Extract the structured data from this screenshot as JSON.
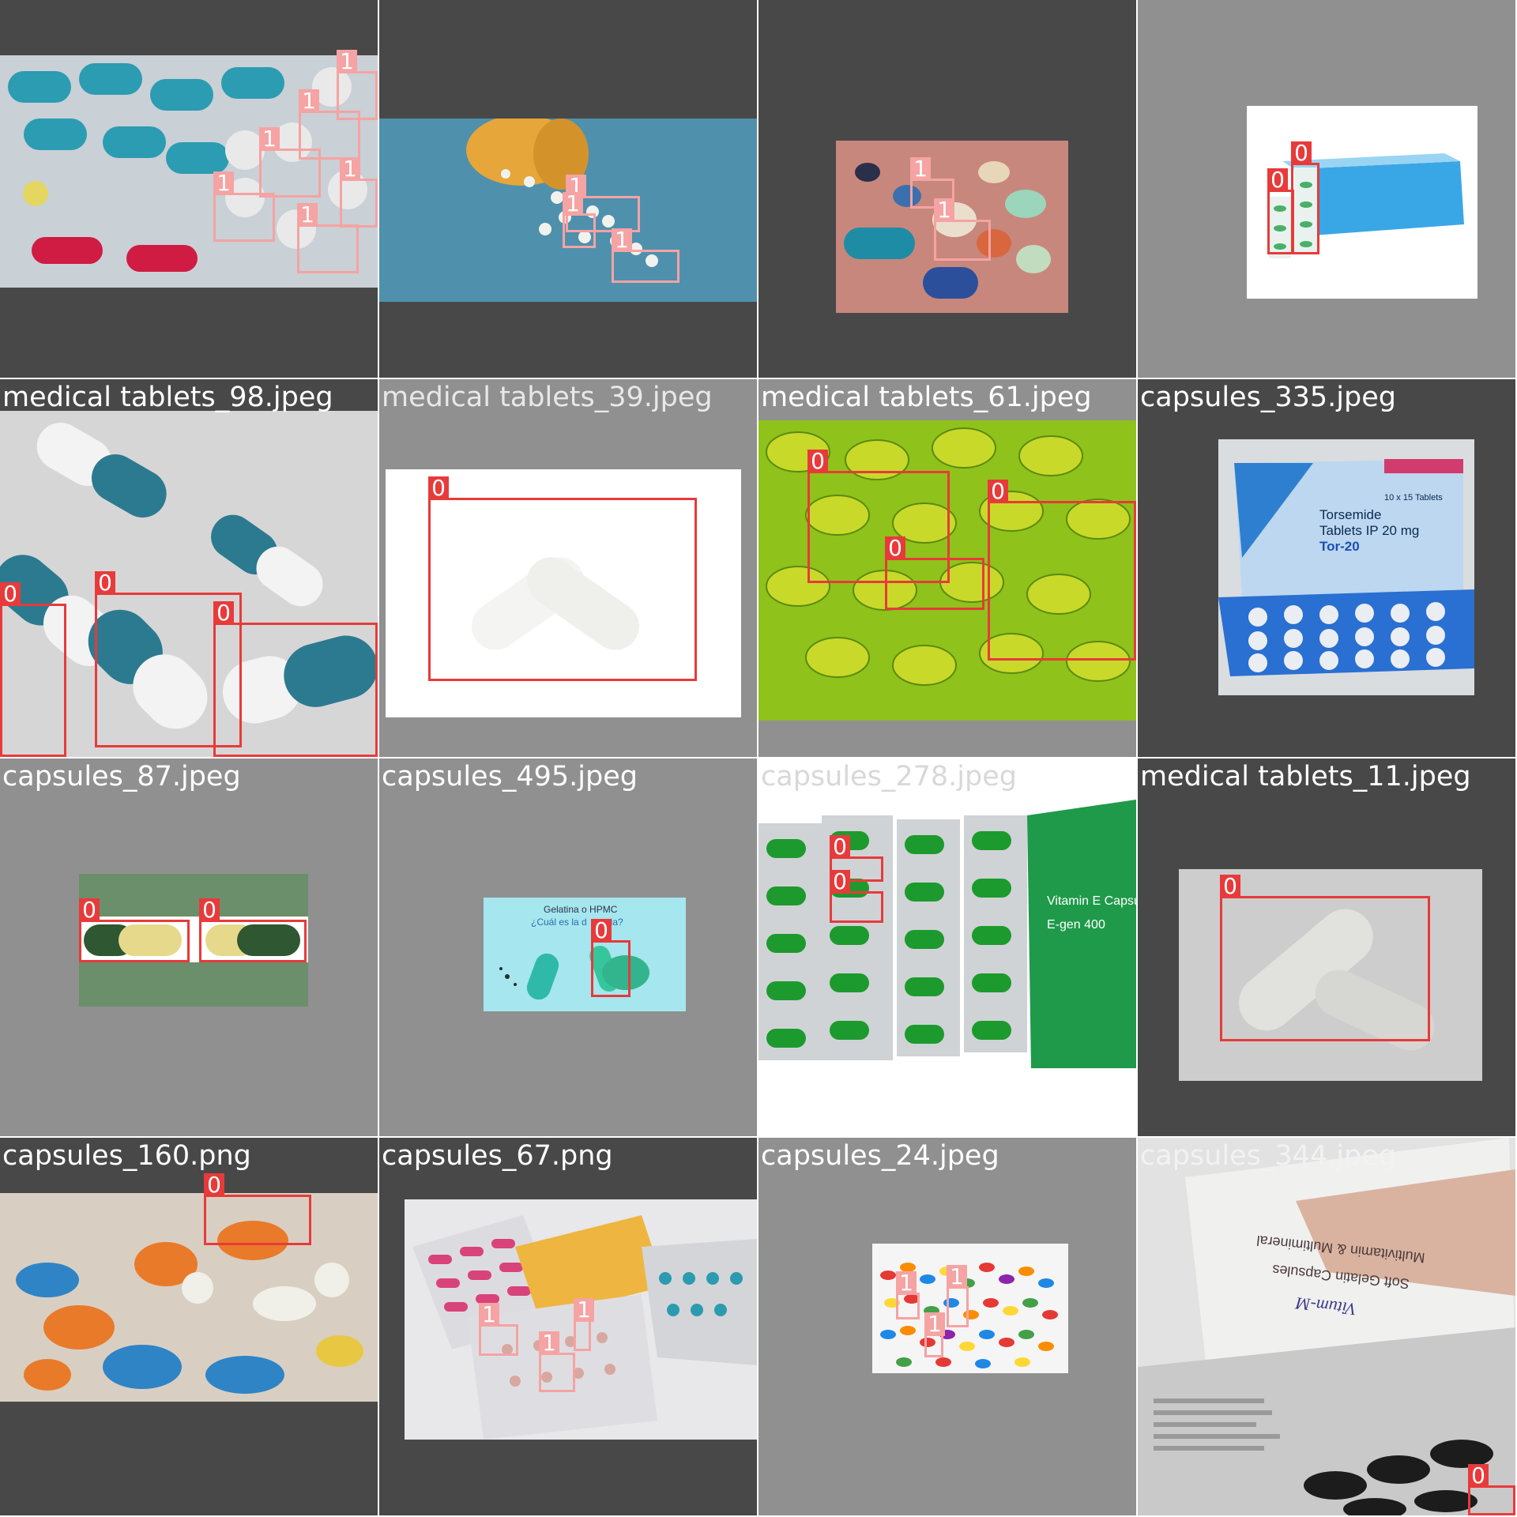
{
  "colors": {
    "class_0": "#e83a3a",
    "class_1": "#f5a3a3",
    "dark_pad": "#484848",
    "light_pad": "#909090"
  },
  "tiles": [
    {
      "caption": "",
      "photo": "blister-pack-teal-red-tablets",
      "labels": [
        "1",
        "1",
        "1",
        "1",
        "1",
        "1"
      ]
    },
    {
      "caption": "",
      "photo": "spilled-pill-bottle-blue",
      "labels": [
        "1",
        "1",
        "1"
      ]
    },
    {
      "caption": "",
      "photo": "mixed-pills-pink-table",
      "labels": [
        "1",
        "1"
      ]
    },
    {
      "caption": "",
      "photo": "blue-medicine-box",
      "labels": [
        "0",
        "0"
      ]
    },
    {
      "caption": "medical tablets_98.jpeg",
      "photo": "teal-white-capsules-closeup",
      "labels": [
        "0",
        "0",
        "0"
      ]
    },
    {
      "caption": "medical tablets_39.jpeg",
      "photo": "white-capsules-white-bg",
      "labels": [
        "0"
      ]
    },
    {
      "caption": "medical tablets_61.jpeg",
      "photo": "green-softgel-capsules",
      "labels": [
        "0",
        "0",
        "0"
      ]
    },
    {
      "caption": "capsules_335.jpeg",
      "photo": "torsemide-box-blister",
      "labels": [],
      "box_text": [
        "10 x 15 Tablets",
        "Torsemide",
        "Tablets IP 20 mg",
        "Tor-20"
      ]
    },
    {
      "caption": "capsules_87.jpeg",
      "photo": "two-green-yellow-capsules",
      "labels": [
        "0",
        "0"
      ]
    },
    {
      "caption": "capsules_495.jpeg",
      "photo": "gelatin-hpmc-banner",
      "labels": [
        "0"
      ],
      "banner_text": [
        "Gelatina o HPMC",
        "¿Cuál es la d",
        "ncia?"
      ]
    },
    {
      "caption": "capsules_278.jpeg",
      "photo": "vitamin-e-green-blisters",
      "labels": [
        "0",
        "0"
      ],
      "box_text": [
        "Vitamin E Capsules U",
        "E-gen 400"
      ]
    },
    {
      "caption": "medical tablets_11.jpeg",
      "photo": "grey-capsules",
      "labels": [
        "0"
      ]
    },
    {
      "caption": "capsules_160.png",
      "photo": "orange-blue-capsules-blur",
      "labels": [
        "0"
      ]
    },
    {
      "caption": "capsules_67.png",
      "photo": "pink-blister-packs",
      "labels": [
        "1",
        "1",
        "1"
      ]
    },
    {
      "caption": "capsules_24.jpeg",
      "photo": "colorful-pill-pile",
      "labels": [
        "1",
        "1",
        "1"
      ]
    },
    {
      "caption": "capsules_344.jpeg",
      "photo": "vitum-multivitamin-box",
      "labels": [
        "0"
      ],
      "box_text": [
        "Multivitamin & Multimineral",
        "Soft Gelatin Capsules",
        "Vitum-M"
      ]
    }
  ]
}
